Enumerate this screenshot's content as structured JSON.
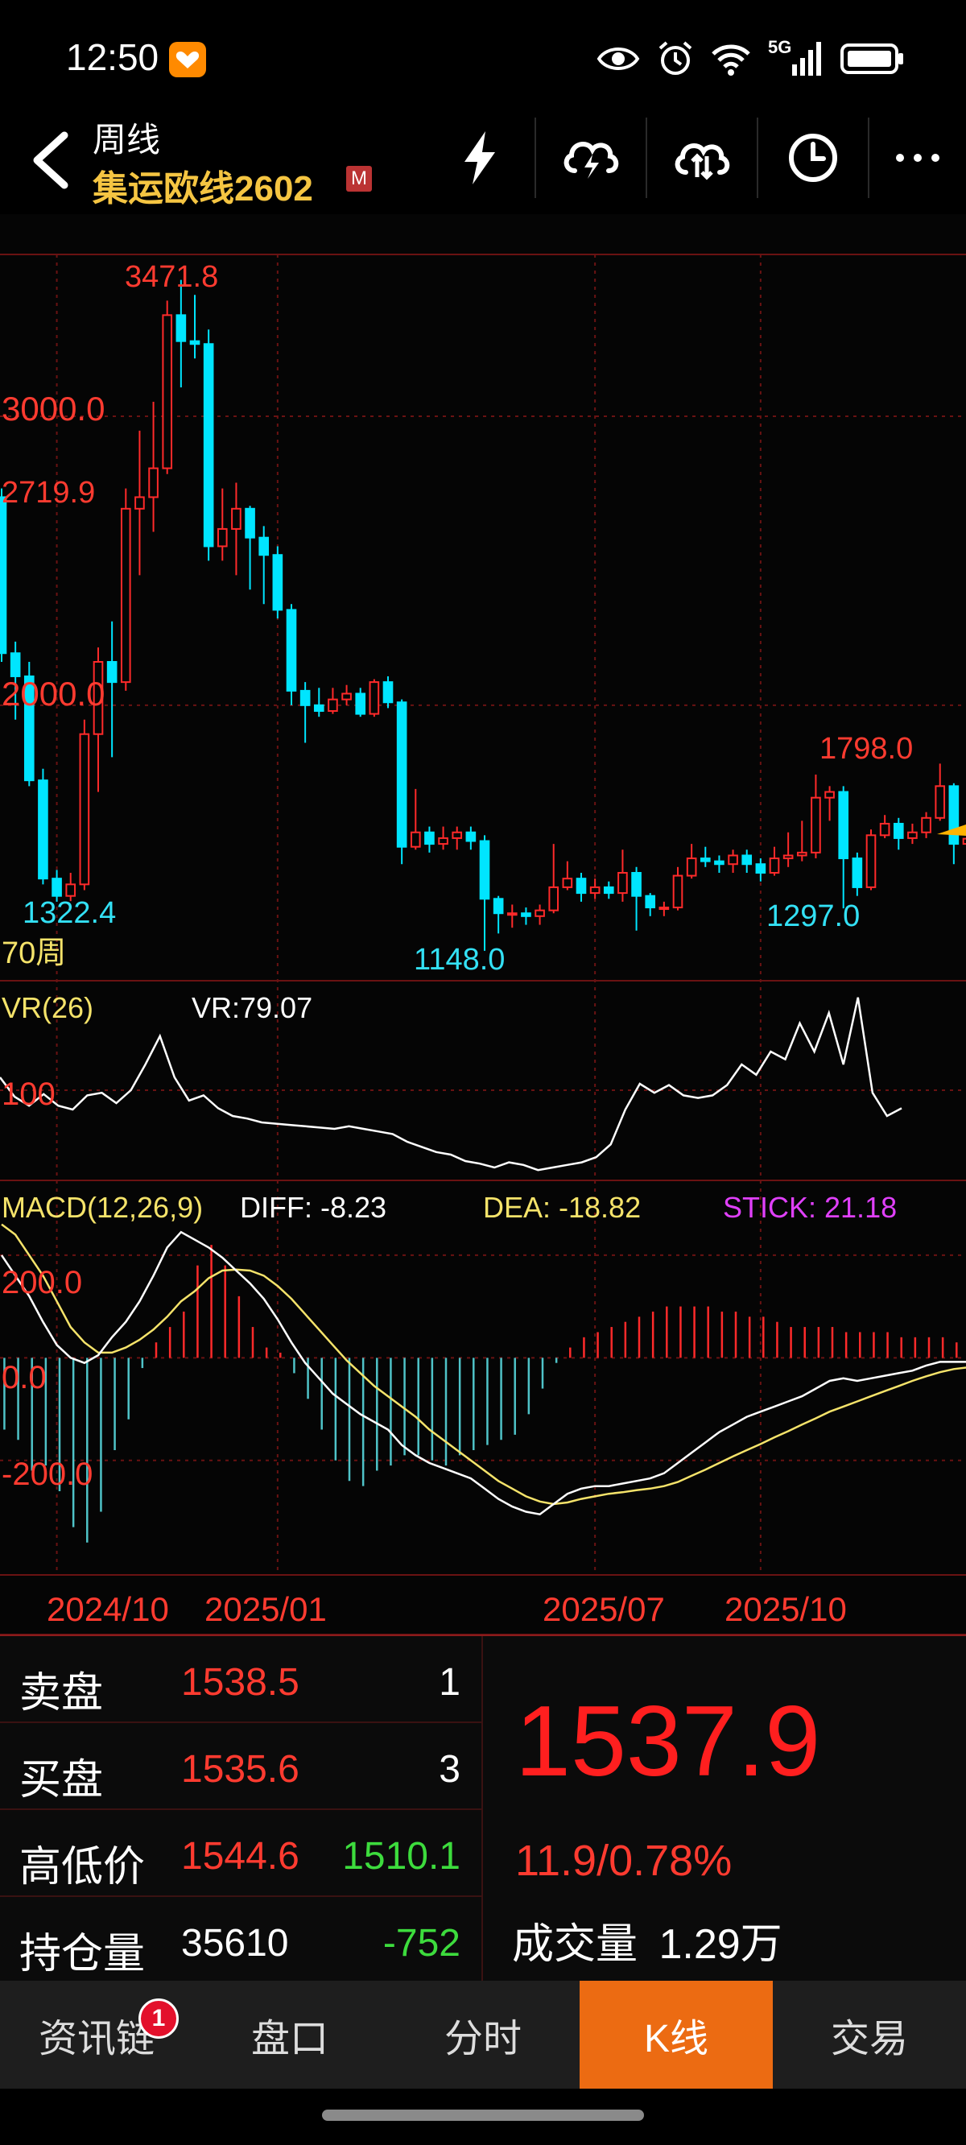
{
  "status_bar": {
    "time": "12:50",
    "network": "5G",
    "icons": [
      "eye-icon",
      "alarm-icon",
      "wifi-icon",
      "signal-icon",
      "battery-icon"
    ]
  },
  "header": {
    "subtitle": "周线",
    "title": "集运欧线2602",
    "badge": "M",
    "tools": [
      "lightning-icon",
      "cloud-lightning-icon",
      "cloud-sync-icon",
      "clock-icon",
      "more-icon"
    ]
  },
  "chart": {
    "price_axis": {
      "labels": [
        "3000.0",
        "2719.9",
        "2000.0"
      ],
      "values": [
        3000,
        2719.9,
        2000
      ],
      "range": [
        1080,
        3560
      ]
    },
    "price_annotations": {
      "high": "3471.8",
      "left_low": "1322.4",
      "mid_low": "1148.0",
      "recent_high": "1798.0",
      "recent_low": "1297.0"
    },
    "period_label": "70周",
    "vr": {
      "title": "VR(26)",
      "value_text": "VR:79.07",
      "axis_label": "100",
      "axis_value": 100,
      "values": [
        110,
        95,
        88,
        97,
        88,
        85,
        96,
        98,
        90,
        100,
        120,
        142,
        110,
        92,
        96,
        86,
        80,
        78,
        75,
        74,
        73,
        72,
        71,
        70,
        72,
        70,
        68,
        66,
        60,
        56,
        52,
        50,
        45,
        43,
        40,
        44,
        42,
        38,
        40,
        42,
        44,
        48,
        58,
        85,
        105,
        98,
        104,
        96,
        94,
        96,
        104,
        120,
        112,
        130,
        124,
        152,
        130,
        160,
        120,
        172,
        98,
        80,
        86
      ],
      "range": [
        30,
        180
      ]
    },
    "macd": {
      "title": "MACD(12,26,9)",
      "diff_text": "DIFF: -8.23",
      "dea_text": "DEA: -18.82",
      "stick_text": "STICK: 21.18",
      "axis_labels": [
        "200.0",
        "0.0",
        "-200.0"
      ],
      "axis_values": [
        200,
        0,
        -200
      ],
      "range": [
        -420,
        330
      ]
    },
    "x_axis": {
      "labels": [
        "2024/10",
        "2025/01",
        "2025/07",
        "2025/10"
      ],
      "positions": [
        4,
        20,
        43,
        55
      ]
    },
    "colors": {
      "up": "#ff2a2a",
      "down": "#00e5ff",
      "grid": "#6a1212",
      "diff": "#ffffff",
      "dea": "#f5e36a",
      "stick": "#e040fb",
      "current": "#ffb300"
    },
    "candles": [
      [
        2720,
        2180,
        2750,
        2150
      ],
      [
        2180,
        2100,
        2220,
        1950
      ],
      [
        2100,
        1740,
        2150,
        1720
      ],
      [
        1740,
        1400,
        1780,
        1380
      ],
      [
        1400,
        1340,
        1430,
        1320
      ],
      [
        1340,
        1380,
        1420,
        1322
      ],
      [
        1380,
        1900,
        1950,
        1360
      ],
      [
        1900,
        2150,
        2200,
        1700
      ],
      [
        2150,
        2080,
        2290,
        1820
      ],
      [
        2080,
        2680,
        2750,
        2050
      ],
      [
        2680,
        2720,
        2950,
        2450
      ],
      [
        2720,
        2820,
        3050,
        2600
      ],
      [
        2820,
        3350,
        3400,
        2800
      ],
      [
        3350,
        3260,
        3472,
        3100
      ],
      [
        3260,
        3250,
        3420,
        3200
      ],
      [
        3250,
        2550,
        3300,
        2500
      ],
      [
        2550,
        2610,
        2750,
        2500
      ],
      [
        2610,
        2680,
        2770,
        2450
      ],
      [
        2680,
        2580,
        2690,
        2400
      ],
      [
        2580,
        2520,
        2620,
        2350
      ],
      [
        2520,
        2330,
        2550,
        2300
      ],
      [
        2330,
        2050,
        2350,
        2000
      ],
      [
        2050,
        2000,
        2080,
        1870
      ],
      [
        2000,
        1980,
        2060,
        1960
      ],
      [
        1980,
        2020,
        2060,
        1970
      ],
      [
        2020,
        2040,
        2070,
        2000
      ],
      [
        2040,
        1970,
        2060,
        1960
      ],
      [
        1970,
        2080,
        2090,
        1960
      ],
      [
        2080,
        2010,
        2100,
        1990
      ],
      [
        2010,
        1510,
        2020,
        1450
      ],
      [
        1510,
        1560,
        1710,
        1500
      ],
      [
        1560,
        1520,
        1580,
        1490
      ],
      [
        1520,
        1540,
        1580,
        1500
      ],
      [
        1540,
        1560,
        1580,
        1500
      ],
      [
        1560,
        1530,
        1580,
        1500
      ],
      [
        1530,
        1330,
        1550,
        1150
      ],
      [
        1330,
        1280,
        1340,
        1210
      ],
      [
        1280,
        1280,
        1310,
        1230
      ],
      [
        1280,
        1270,
        1300,
        1240
      ],
      [
        1270,
        1290,
        1310,
        1240
      ],
      [
        1290,
        1370,
        1520,
        1280
      ],
      [
        1370,
        1400,
        1460,
        1360
      ],
      [
        1400,
        1350,
        1420,
        1320
      ],
      [
        1350,
        1370,
        1400,
        1330
      ],
      [
        1370,
        1350,
        1390,
        1330
      ],
      [
        1350,
        1420,
        1500,
        1320
      ],
      [
        1420,
        1340,
        1440,
        1220
      ],
      [
        1340,
        1300,
        1350,
        1270
      ],
      [
        1300,
        1300,
        1320,
        1270
      ],
      [
        1300,
        1410,
        1440,
        1290
      ],
      [
        1410,
        1470,
        1520,
        1400
      ],
      [
        1470,
        1460,
        1510,
        1440
      ],
      [
        1460,
        1450,
        1480,
        1420
      ],
      [
        1450,
        1480,
        1500,
        1420
      ],
      [
        1480,
        1450,
        1500,
        1420
      ],
      [
        1450,
        1420,
        1470,
        1390
      ],
      [
        1420,
        1470,
        1510,
        1410
      ],
      [
        1470,
        1480,
        1560,
        1440
      ],
      [
        1480,
        1490,
        1600,
        1460
      ],
      [
        1490,
        1680,
        1760,
        1470
      ],
      [
        1680,
        1700,
        1720,
        1600
      ],
      [
        1700,
        1470,
        1720,
        1297
      ],
      [
        1470,
        1370,
        1490,
        1340
      ],
      [
        1370,
        1550,
        1570,
        1360
      ],
      [
        1550,
        1590,
        1620,
        1540
      ],
      [
        1590,
        1540,
        1610,
        1500
      ],
      [
        1540,
        1560,
        1590,
        1520
      ],
      [
        1560,
        1610,
        1630,
        1540
      ],
      [
        1610,
        1720,
        1798,
        1600
      ],
      [
        1720,
        1520,
        1730,
        1450
      ],
      [
        1520,
        1538,
        1550,
        1510
      ]
    ],
    "macd_diff": [
      200,
      160,
      120,
      70,
      25,
      0,
      -10,
      5,
      40,
      70,
      110,
      160,
      215,
      245,
      230,
      215,
      195,
      170,
      145,
      115,
      75,
      30,
      -10,
      -40,
      -70,
      -90,
      -110,
      -125,
      -140,
      -170,
      -190,
      -205,
      -215,
      -225,
      -235,
      -255,
      -275,
      -290,
      -300,
      -305,
      -285,
      -265,
      -255,
      -250,
      -250,
      -245,
      -240,
      -235,
      -225,
      -205,
      -185,
      -165,
      -145,
      -130,
      -115,
      -105,
      -95,
      -85,
      -75,
      -60,
      -45,
      -40,
      -45,
      -40,
      -35,
      -30,
      -25,
      -15,
      -8,
      -8,
      -8
    ],
    "macd_dea": [
      260,
      240,
      200,
      160,
      110,
      60,
      30,
      10,
      10,
      20,
      35,
      55,
      80,
      110,
      130,
      155,
      170,
      172,
      170,
      160,
      140,
      115,
      85,
      55,
      25,
      -5,
      -30,
      -55,
      -75,
      -95,
      -115,
      -140,
      -160,
      -180,
      -200,
      -220,
      -240,
      -255,
      -270,
      -280,
      -285,
      -282,
      -275,
      -270,
      -265,
      -262,
      -258,
      -255,
      -250,
      -242,
      -230,
      -218,
      -205,
      -192,
      -180,
      -168,
      -155,
      -143,
      -130,
      -118,
      -105,
      -95,
      -85,
      -75,
      -65,
      -55,
      -45,
      -36,
      -28,
      -22,
      -18.82
    ],
    "macd_stick": [
      -140,
      -160,
      -220,
      -210,
      -260,
      -330,
      -360,
      -300,
      -180,
      -120,
      -20,
      30,
      60,
      90,
      180,
      220,
      180,
      120,
      60,
      20,
      10,
      -30,
      -80,
      -140,
      -200,
      -240,
      -250,
      -220,
      -210,
      -190,
      -190,
      -200,
      -210,
      -190,
      -180,
      -170,
      -160,
      -150,
      -110,
      -60,
      -10,
      20,
      40,
      50,
      60,
      70,
      80,
      90,
      100,
      100,
      100,
      100,
      90,
      90,
      80,
      80,
      70,
      60,
      60,
      60,
      60,
      50,
      50,
      50,
      50,
      40,
      40,
      40,
      40,
      30,
      21.18
    ]
  },
  "quote": {
    "sell_label": "卖盘",
    "sell_price": "1538.5",
    "sell_qty": "1",
    "buy_label": "买盘",
    "buy_price": "1535.6",
    "buy_qty": "3",
    "hl_label": "高低价",
    "high": "1544.6",
    "low": "1510.1",
    "oi_label": "持仓量",
    "oi": "35610",
    "oi_change": "-752",
    "last_price": "1537.9",
    "change": "11.9/0.78%",
    "volume_label": "成交量",
    "volume": "1.29万"
  },
  "tabs": [
    {
      "label": "资讯链",
      "badge": "1",
      "active": false
    },
    {
      "label": "盘口",
      "active": false
    },
    {
      "label": "分时",
      "active": false
    },
    {
      "label": "K线",
      "active": true
    },
    {
      "label": "交易",
      "active": false
    }
  ]
}
